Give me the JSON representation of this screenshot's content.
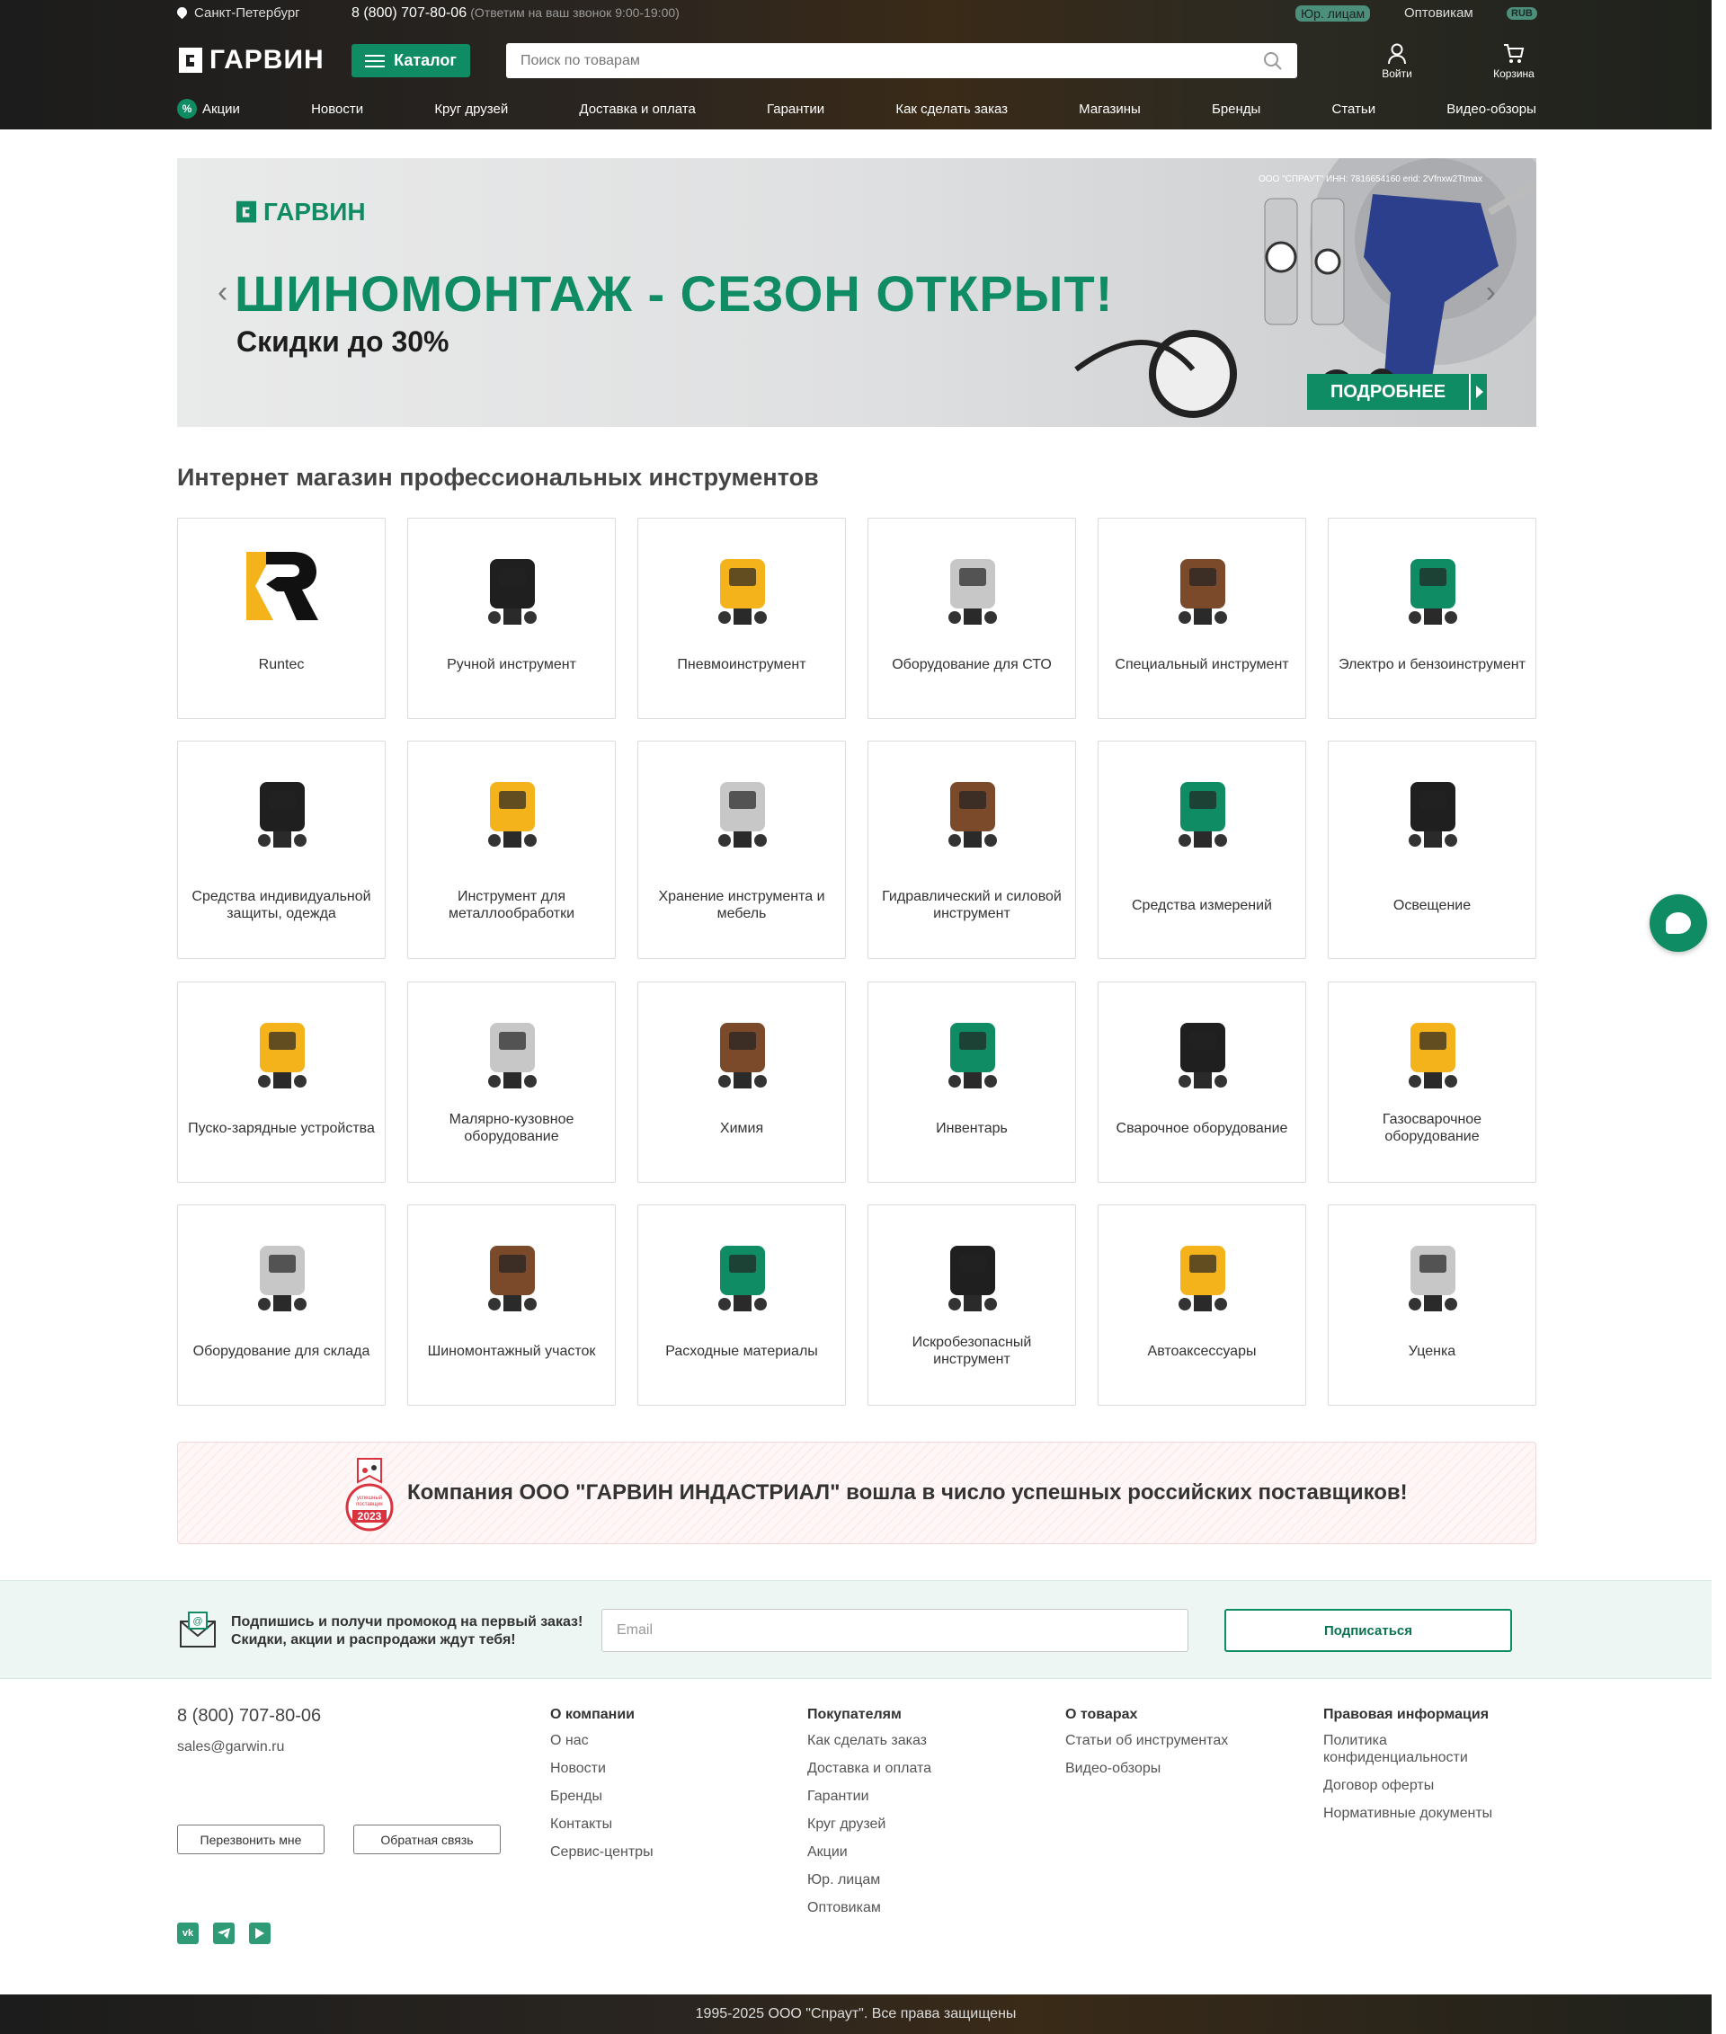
{
  "topbar": {
    "city": "Санкт-Петербург",
    "phone": "8 (800) 707-80-06",
    "phone_note": "(Ответим на ваш звонок 9:00-19:00)",
    "yur": "Юр. лицам",
    "opt": "Оптовикам",
    "currency": "RUB"
  },
  "header": {
    "logo": "ГАРВИН",
    "catalog": "Каталог",
    "search_placeholder": "Поиск по товарам",
    "login": "Войти",
    "cart": "Корзина"
  },
  "nav": [
    "Акции",
    "Новости",
    "Круг друзей",
    "Доставка и оплата",
    "Гарантии",
    "Как сделать заказ",
    "Магазины",
    "Бренды",
    "Статьи",
    "Видео-обзоры"
  ],
  "banner": {
    "logo": "ГАРВИН",
    "title": "ШИНОМОНТАЖ - СЕЗОН ОТКРЫТ!",
    "subtitle": "Скидки до 30%",
    "legal": "ООО \"СПРАУТ\" ИНН: 7816654160 erid: 2Vfnxw2Ttmax",
    "button": "ПОДРОБНЕЕ"
  },
  "heading": "Интернет магазин профессиональных инструментов",
  "categories": [
    [
      "Runtec",
      "Ручной инструмент",
      "Пневмоинструмент",
      "Оборудование для СТО",
      "Специальный инструмент",
      "Электро и бензоинструмент"
    ],
    [
      "Средства индивидуальной защиты, одежда",
      "Инструмент для металлообработки",
      "Хранение инструмента и мебель",
      "Гидравлический и силовой инструмент",
      "Средства измерений",
      "Освещение"
    ],
    [
      "Пуско-зарядные устройства",
      "Малярно-кузовное оборудование",
      "Химия",
      "Инвентарь",
      "Сварочное оборудование",
      "Газосварочное оборудование"
    ],
    [
      "Оборудование для склада",
      "Шиномонтажный участок",
      "Расходные материалы",
      "Искробезопасный инструмент",
      "Автоаксессуары",
      "Уценка"
    ]
  ],
  "award": {
    "text": "Компания ООО \"ГАРВИН ИНДАСТРИАЛ\" вошла в число успешных российских поставщиков!",
    "badge_line1": "успешный",
    "badge_line2": "поставщик",
    "badge_year": "2023"
  },
  "subscribe": {
    "line1": "Подпишись и получи промокод на первый заказ!",
    "line2": "Скидки, акции и распродажи ждут тебя!",
    "placeholder": "Email",
    "button": "Подписаться"
  },
  "footer": {
    "phone": "8 (800) 707-80-06",
    "email": "sales@garwin.ru",
    "callback": "Перезвонить мне",
    "feedback": "Обратная связь",
    "cols": [
      {
        "title": "О компании",
        "items": [
          "О нас",
          "Новости",
          "Бренды",
          "Контакты",
          "Сервис-центры"
        ]
      },
      {
        "title": "Покупателям",
        "items": [
          "Как сделать заказ",
          "Доставка и оплата",
          "Гарантии",
          "Круг друзей",
          "Акции",
          "Юр. лицам",
          "Оптовикам"
        ]
      },
      {
        "title": "О товарах",
        "items": [
          "Статьи об инструментах",
          "Видео-обзоры"
        ]
      },
      {
        "title": "Правовая информация",
        "items": [
          "Политика конфиденциальности",
          "Договор оферты",
          "Нормативные документы"
        ]
      }
    ],
    "copyright": "1995-2025 ООО \"Спраут\". Все права защищены"
  },
  "colors": {
    "brand": "#0f8c63",
    "header_dark": "#1c1c1c"
  }
}
